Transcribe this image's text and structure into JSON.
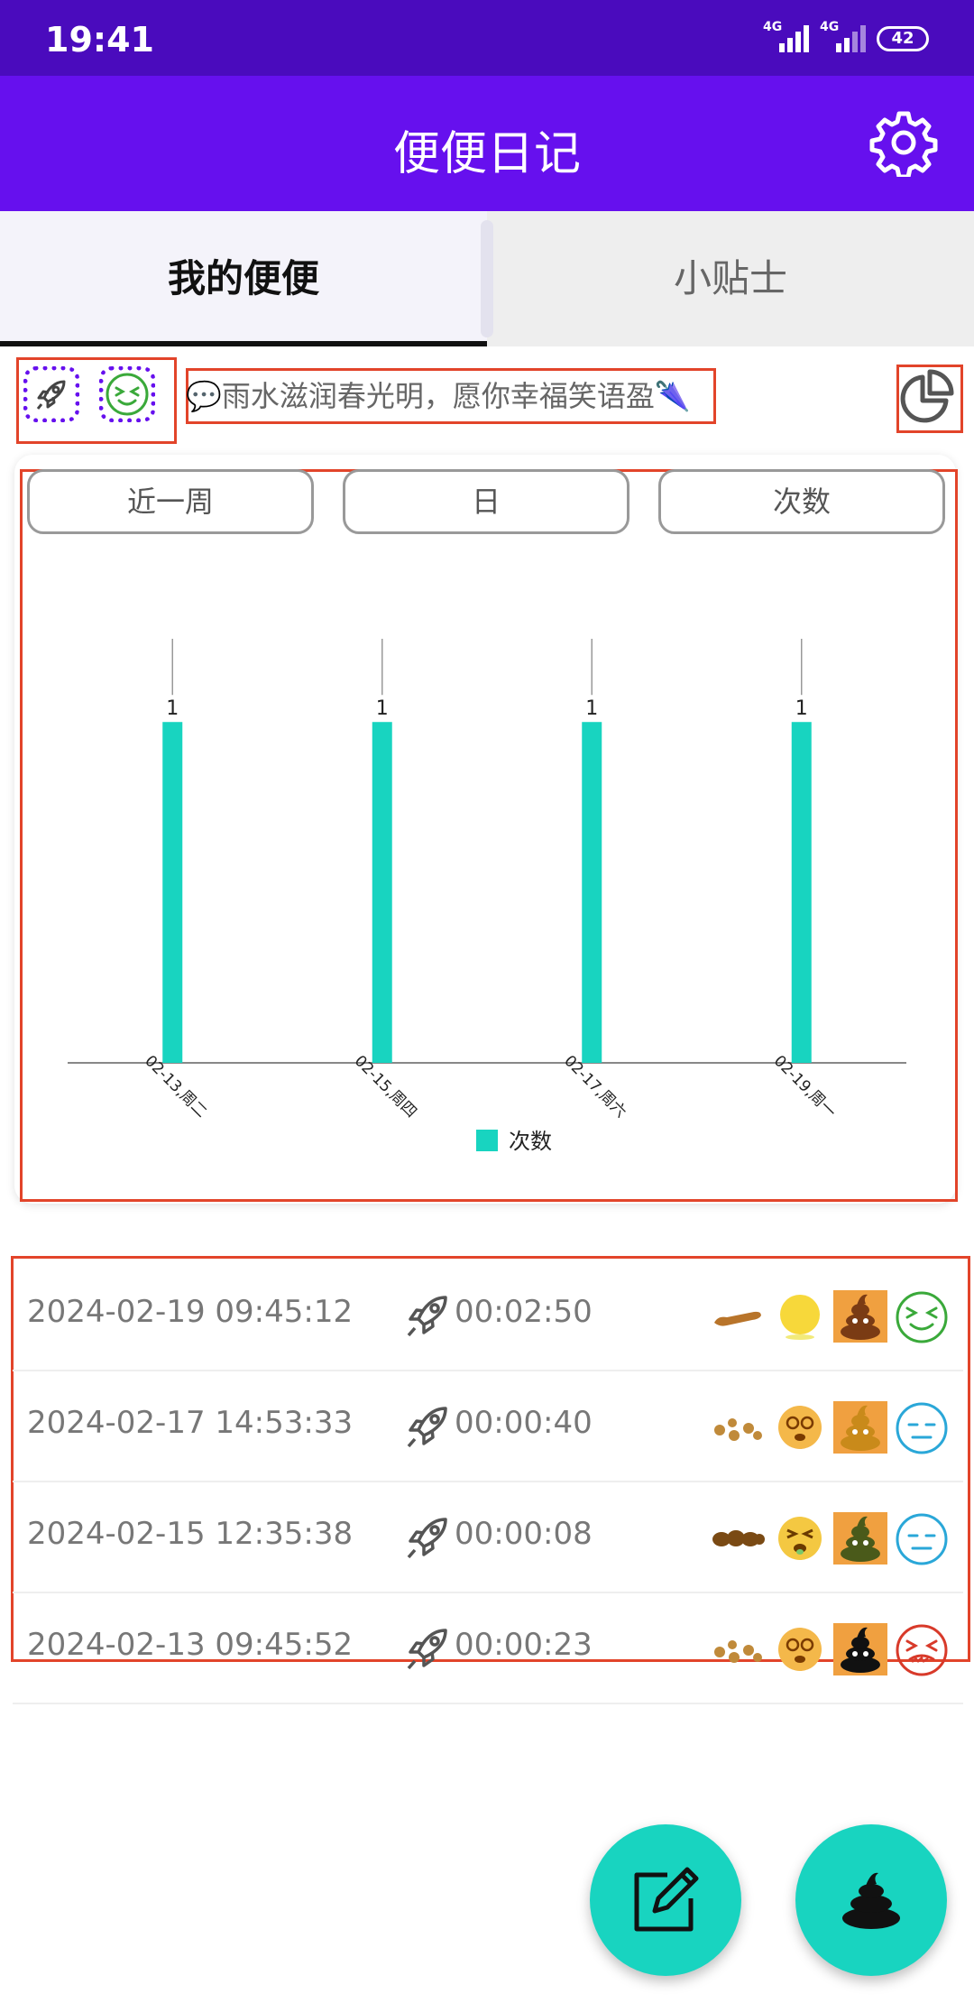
{
  "status_bar": {
    "time": "19:41",
    "network1": "4G",
    "network2": "4G",
    "battery": "42"
  },
  "app_bar": {
    "title": "便便日记",
    "settings_icon": "gear-icon"
  },
  "tabs": [
    {
      "label": "我的便便",
      "active": true
    },
    {
      "label": "小贴士",
      "active": false
    }
  ],
  "quick_icons": [
    "rocket-icon",
    "happy-face-icon"
  ],
  "quote": "💬雨水滋润春光明，愿你幸福笑语盈🌂",
  "stats_icon": "pie-chart-icon",
  "filters": {
    "range": "近一周",
    "unit": "日",
    "metric": "次数"
  },
  "chart_data": {
    "type": "bar",
    "categories": [
      "02-13,周二",
      "02-15,周四",
      "02-17,周六",
      "02-19,周一"
    ],
    "series": [
      {
        "name": "次数",
        "values": [
          1,
          1,
          1,
          1
        ],
        "color": "#18d4c0"
      }
    ],
    "data_labels": [
      "1",
      "1",
      "1",
      "1"
    ],
    "ylim": [
      0,
      1.35
    ],
    "grid": false,
    "legend": "bottom"
  },
  "records": [
    {
      "datetime": "2024-02-19 09:45:12",
      "duration": "00:02:50",
      "shape_icon": "sausage-shape-icon",
      "feel_icon": "yellow-face-icon",
      "poop_icon": "brown-poop-icon",
      "mood_icon": "green-happy-face-icon",
      "mood_color": "#3aa93a"
    },
    {
      "datetime": "2024-02-17 14:53:33",
      "duration": "00:00:40",
      "shape_icon": "fragments-shape-icon",
      "feel_icon": "dizzy-face-icon",
      "poop_icon": "golden-poop-icon",
      "mood_icon": "blue-neutral-face-icon",
      "mood_color": "#2aa7d8"
    },
    {
      "datetime": "2024-02-15 12:35:38",
      "duration": "00:00:08",
      "shape_icon": "lumpy-shape-icon",
      "feel_icon": "squint-face-icon",
      "poop_icon": "green-poop-icon",
      "mood_icon": "blue-neutral-face-icon",
      "mood_color": "#2aa7d8"
    },
    {
      "datetime": "2024-02-13 09:45:52",
      "duration": "00:00:23",
      "shape_icon": "fragments-shape-icon",
      "feel_icon": "dizzy-face-icon",
      "poop_icon": "black-poop-icon",
      "mood_icon": "red-angry-face-icon",
      "mood_color": "#d83a2a"
    }
  ],
  "fabs": [
    "edit-icon",
    "poop-icon"
  ],
  "colors": {
    "status_bar": "#4a0bbd",
    "app_bar": "#6610ee",
    "accent": "#18d4c0",
    "highlight_box": "#e2442a"
  }
}
